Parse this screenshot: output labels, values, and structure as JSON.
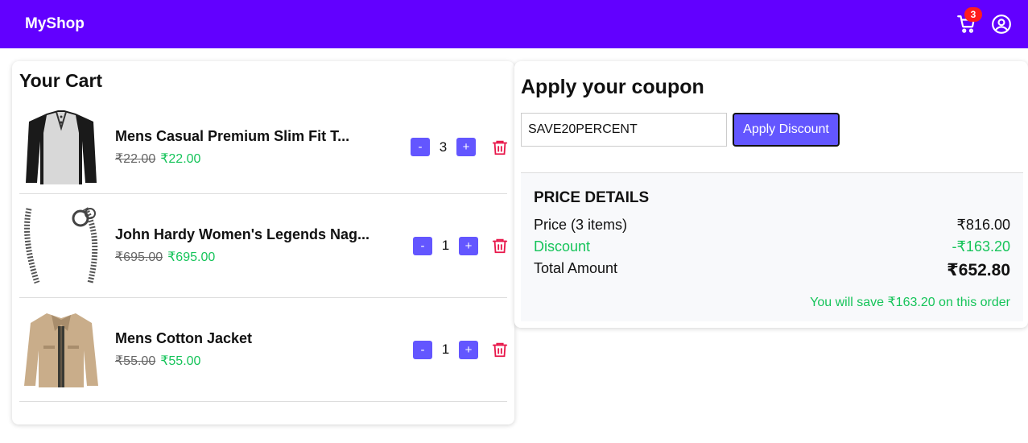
{
  "navbar": {
    "brand": "MyShop",
    "cart_count": "3",
    "bg_color": "#6200ff"
  },
  "cart": {
    "title": "Your Cart",
    "items": [
      {
        "name": "Mens Casual Premium Slim Fit T...",
        "old_price": "₹22.00",
        "price": "₹22.00",
        "qty": "3",
        "image": "tshirt"
      },
      {
        "name": "John Hardy Women's Legends Nag...",
        "old_price": "₹695.00",
        "price": "₹695.00",
        "qty": "1",
        "image": "bracelet"
      },
      {
        "name": "Mens Cotton Jacket",
        "old_price": "₹55.00",
        "price": "₹55.00",
        "qty": "1",
        "image": "jacket"
      }
    ],
    "minus_label": "-",
    "plus_label": "+"
  },
  "coupon": {
    "title": "Apply your coupon",
    "input_value": "SAVE20PERCENT",
    "button_label": "Apply Discount"
  },
  "price_details": {
    "title": "PRICE DETAILS",
    "price_label": "Price (3 items)",
    "price_value": "₹816.00",
    "discount_label": "Discount",
    "discount_value": "-₹163.20",
    "total_label": "Total Amount",
    "total_value": "₹652.80",
    "save_note": "You will save ₹163.20 on this order"
  },
  "colors": {
    "accent": "#6356ff",
    "green": "#16c45a",
    "badge": "#ff1d1d",
    "trash": "#e8174a"
  }
}
